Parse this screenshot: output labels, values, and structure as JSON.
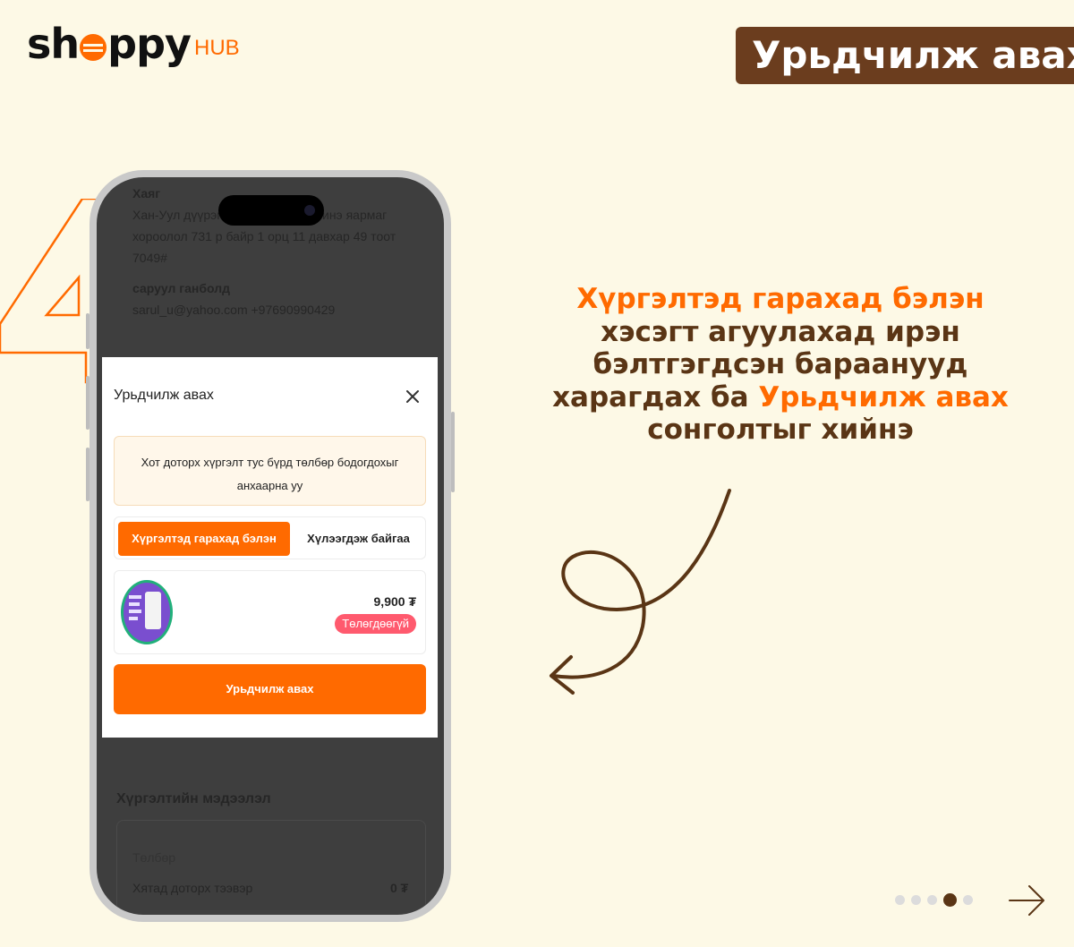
{
  "brand": {
    "main_pre": "sh",
    "main_post": "ppy",
    "sub": "HUB"
  },
  "header": {
    "title": "Урьдчилж авах"
  },
  "step_number": "4",
  "phone": {
    "background": {
      "address_label": "Хаяг",
      "address_line1": "Хан-Уул дүүрэг",
      "address_line1_end": "инэ яармаг",
      "address_line2": "хороолол 731 р байр 1 орц 11 давхар 49 тоот",
      "address_line3": "7049#",
      "contact_name": "саруул ганболд",
      "contact_info": "sarul_u@yahoo.com +97690990429",
      "delivery_heading": "Хүргэлтийн мэдээлэл",
      "payment_label": "Төлбөр",
      "shipping_label": "Хятад доторх тээвэр",
      "shipping_value": "0 ₮"
    },
    "modal": {
      "title": "Урьдчилж авах",
      "notice": "Хот доторх хүргэлт тус бүрд төлбөр бодогдохыг анхаарна уу",
      "tab_ready": "Хүргэлтэд гарахад бэлэн",
      "tab_waiting": "Хүлээгдэж байгаа",
      "product_price": "9,900 ₮",
      "product_status": "Төлөгдөөгүй",
      "buy_button": "Урьдчилж авах"
    }
  },
  "description": {
    "hl1": "Хүргэлтэд гарахад бэлэн",
    "t1": " хэсэгт агуулахад ирэн бэлтгэгдсэн бараанууд харагдах ба ",
    "hl2": "Урьдчилж авах",
    "t2": " сонголтыг хийнэ"
  },
  "pagination": {
    "total": 5,
    "active_index": 3
  },
  "colors": {
    "accent": "#ff6a00",
    "brown": "#6b3d1e",
    "background": "#fdf9e6",
    "badge_red": "#ff5a6e"
  }
}
